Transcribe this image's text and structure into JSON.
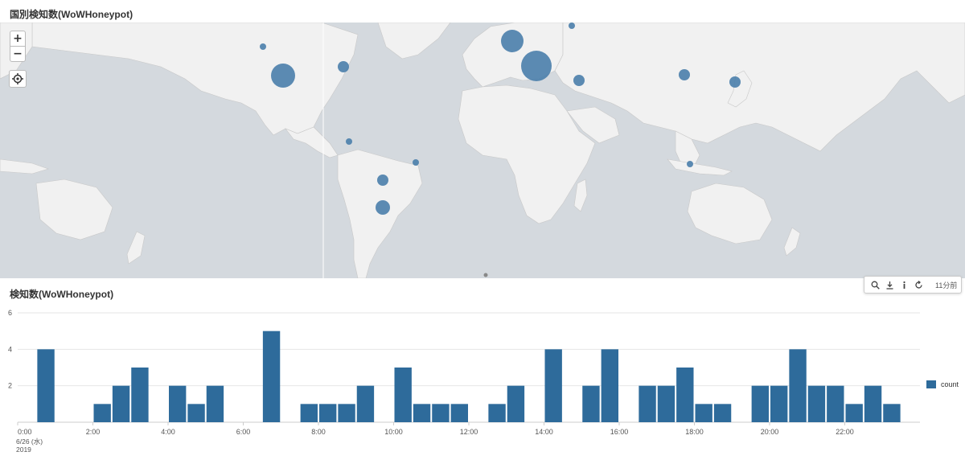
{
  "map_panel": {
    "title": "国別検知数(WoWHoneypot)",
    "controls": {
      "zoom_in": "+",
      "zoom_out": "−"
    },
    "colors": {
      "water": "#d4d9de",
      "land": "#f1f1f1",
      "marker": "#4a7eab"
    }
  },
  "chart_panel": {
    "title": "検知数(WoWHoneypot)",
    "toolbar": {
      "ago": "11分前"
    }
  },
  "chart_data": {
    "type": "bar",
    "ylim": [
      0,
      6
    ],
    "y_ticks": [
      2,
      4,
      6
    ],
    "x_ticks": [
      "0:00",
      "2:00",
      "4:00",
      "6:00",
      "8:00",
      "10:00",
      "12:00",
      "14:00",
      "16:00",
      "18:00",
      "20:00",
      "22:00"
    ],
    "x_sublabels": [
      "6/26 (水)",
      "2019"
    ],
    "bin_minutes": 30,
    "values": [
      0,
      4,
      0,
      0,
      1,
      2,
      3,
      0,
      2,
      1,
      2,
      0,
      0,
      5,
      0,
      1,
      1,
      1,
      2,
      0,
      3,
      1,
      1,
      1,
      0,
      1,
      2,
      0,
      4,
      0,
      2,
      4,
      0,
      2,
      2,
      3,
      1,
      1,
      0,
      2,
      2,
      4,
      2,
      2,
      1,
      2,
      1,
      0
    ],
    "series": [
      {
        "name": "count"
      }
    ],
    "color": "#2e6b9b",
    "grid": true,
    "legend": "right"
  }
}
